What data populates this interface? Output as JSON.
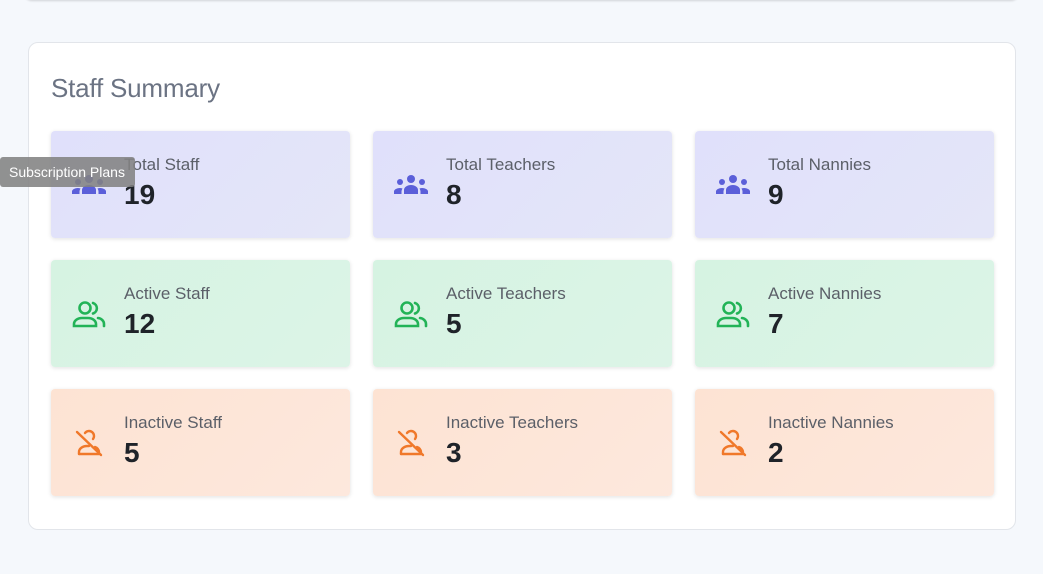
{
  "panel": {
    "title": "Staff Summary"
  },
  "tooltip": {
    "text": "Subscription Plans"
  },
  "cards": [
    {
      "label": "Total Staff",
      "value": "19",
      "icon": "group-icon",
      "theme": "purple"
    },
    {
      "label": "Total Teachers",
      "value": "8",
      "icon": "group-icon",
      "theme": "purple"
    },
    {
      "label": "Total Nannies",
      "value": "9",
      "icon": "group-icon",
      "theme": "purple"
    },
    {
      "label": "Active Staff",
      "value": "12",
      "icon": "people-outline-icon",
      "theme": "green"
    },
    {
      "label": "Active Teachers",
      "value": "5",
      "icon": "people-outline-icon",
      "theme": "green"
    },
    {
      "label": "Active Nannies",
      "value": "7",
      "icon": "people-outline-icon",
      "theme": "green"
    },
    {
      "label": "Inactive Staff",
      "value": "5",
      "icon": "person-off-icon",
      "theme": "orange"
    },
    {
      "label": "Inactive Teachers",
      "value": "3",
      "icon": "person-off-icon",
      "theme": "orange"
    },
    {
      "label": "Inactive Nannies",
      "value": "2",
      "icon": "person-off-icon",
      "theme": "orange"
    }
  ],
  "colors": {
    "purple_icon": "#5b5fd9",
    "green_icon": "#22b357",
    "orange_icon": "#f0782a",
    "page_background": "#f5f8fc",
    "title_text": "#6b7383",
    "value_text": "#1f2329"
  }
}
